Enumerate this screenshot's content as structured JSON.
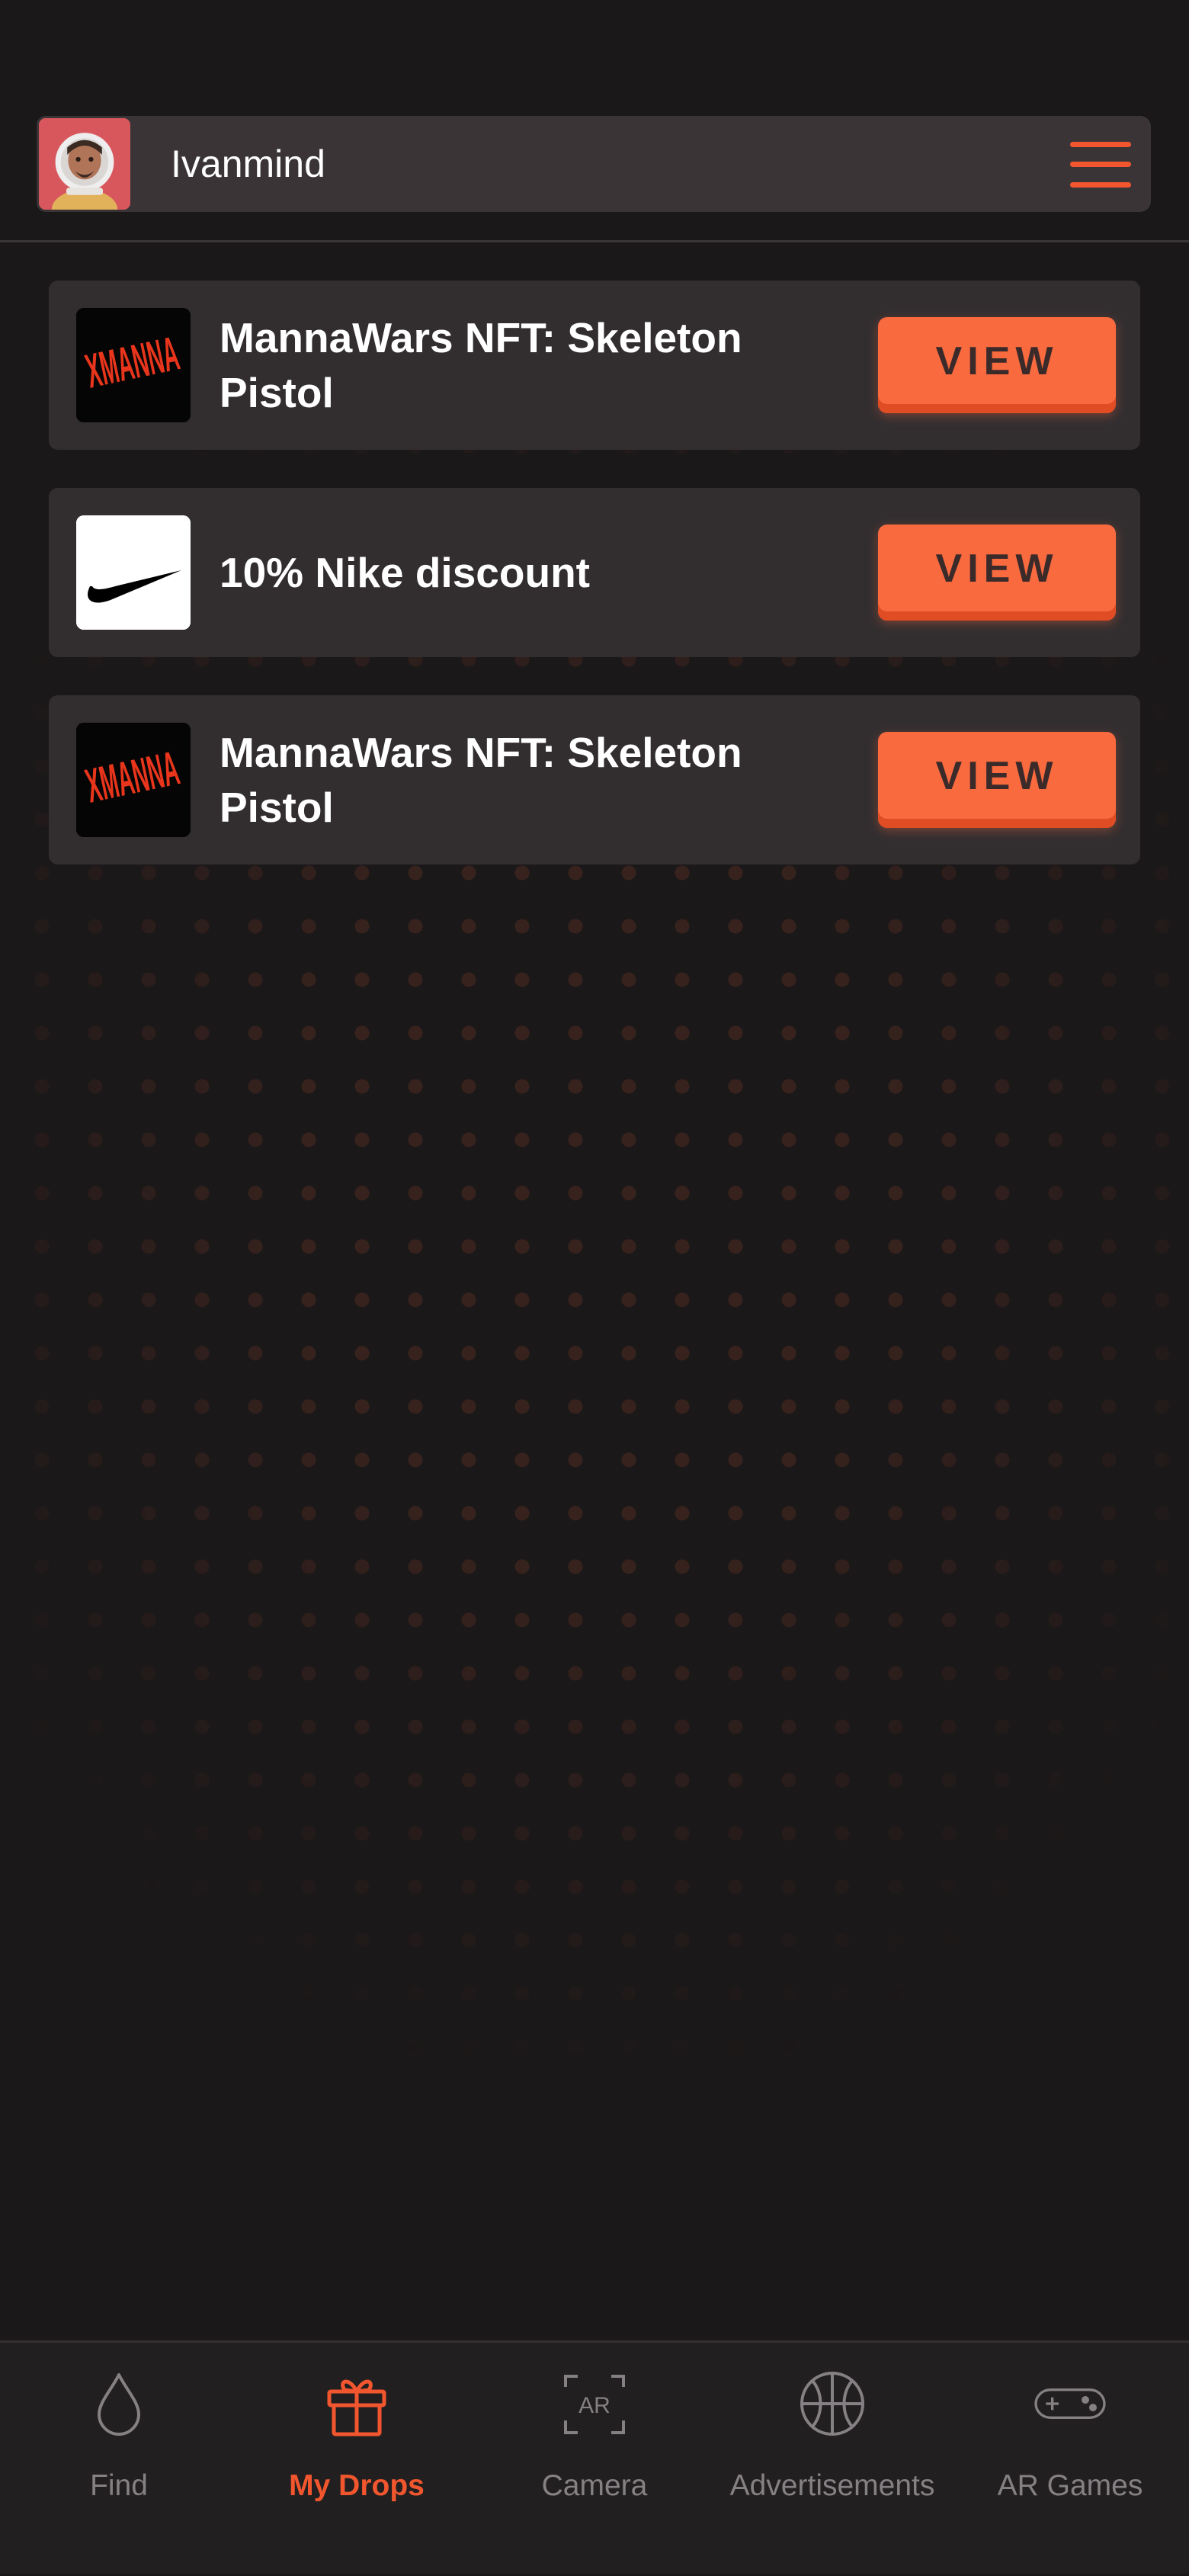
{
  "colors": {
    "background": "#1b1819",
    "surface": "#322e30",
    "header_surface": "#3a3436",
    "accent": "#f96a3f",
    "accent_dark": "#f1562e",
    "nav_inactive": "#858083"
  },
  "header": {
    "username": "Ivanmind",
    "avatar_icon": "astronaut-avatar",
    "menu_icon": "hamburger-icon"
  },
  "drops": [
    {
      "title": "MannaWars NFT: Skeleton Pistol",
      "thumbnail": "xmanna-logo",
      "thumb_text": "XMANNA",
      "button_label": "VIEW"
    },
    {
      "title": "10% Nike discount",
      "thumbnail": "nike-swoosh-logo",
      "button_label": "VIEW"
    },
    {
      "title": "MannaWars NFT: Skeleton Pistol",
      "thumbnail": "xmanna-logo",
      "thumb_text": "XMANNA",
      "button_label": "VIEW"
    }
  ],
  "nav": {
    "active": "My Drops",
    "items": [
      {
        "label": "Find",
        "icon": "drop-icon"
      },
      {
        "label": "My Drops",
        "icon": "gift-icon"
      },
      {
        "label": "Camera",
        "icon": "ar-camera-icon",
        "icon_text": "AR"
      },
      {
        "label": "Advertisements",
        "icon": "basketball-icon"
      },
      {
        "label": "AR Games",
        "icon": "gamepad-icon"
      }
    ]
  }
}
